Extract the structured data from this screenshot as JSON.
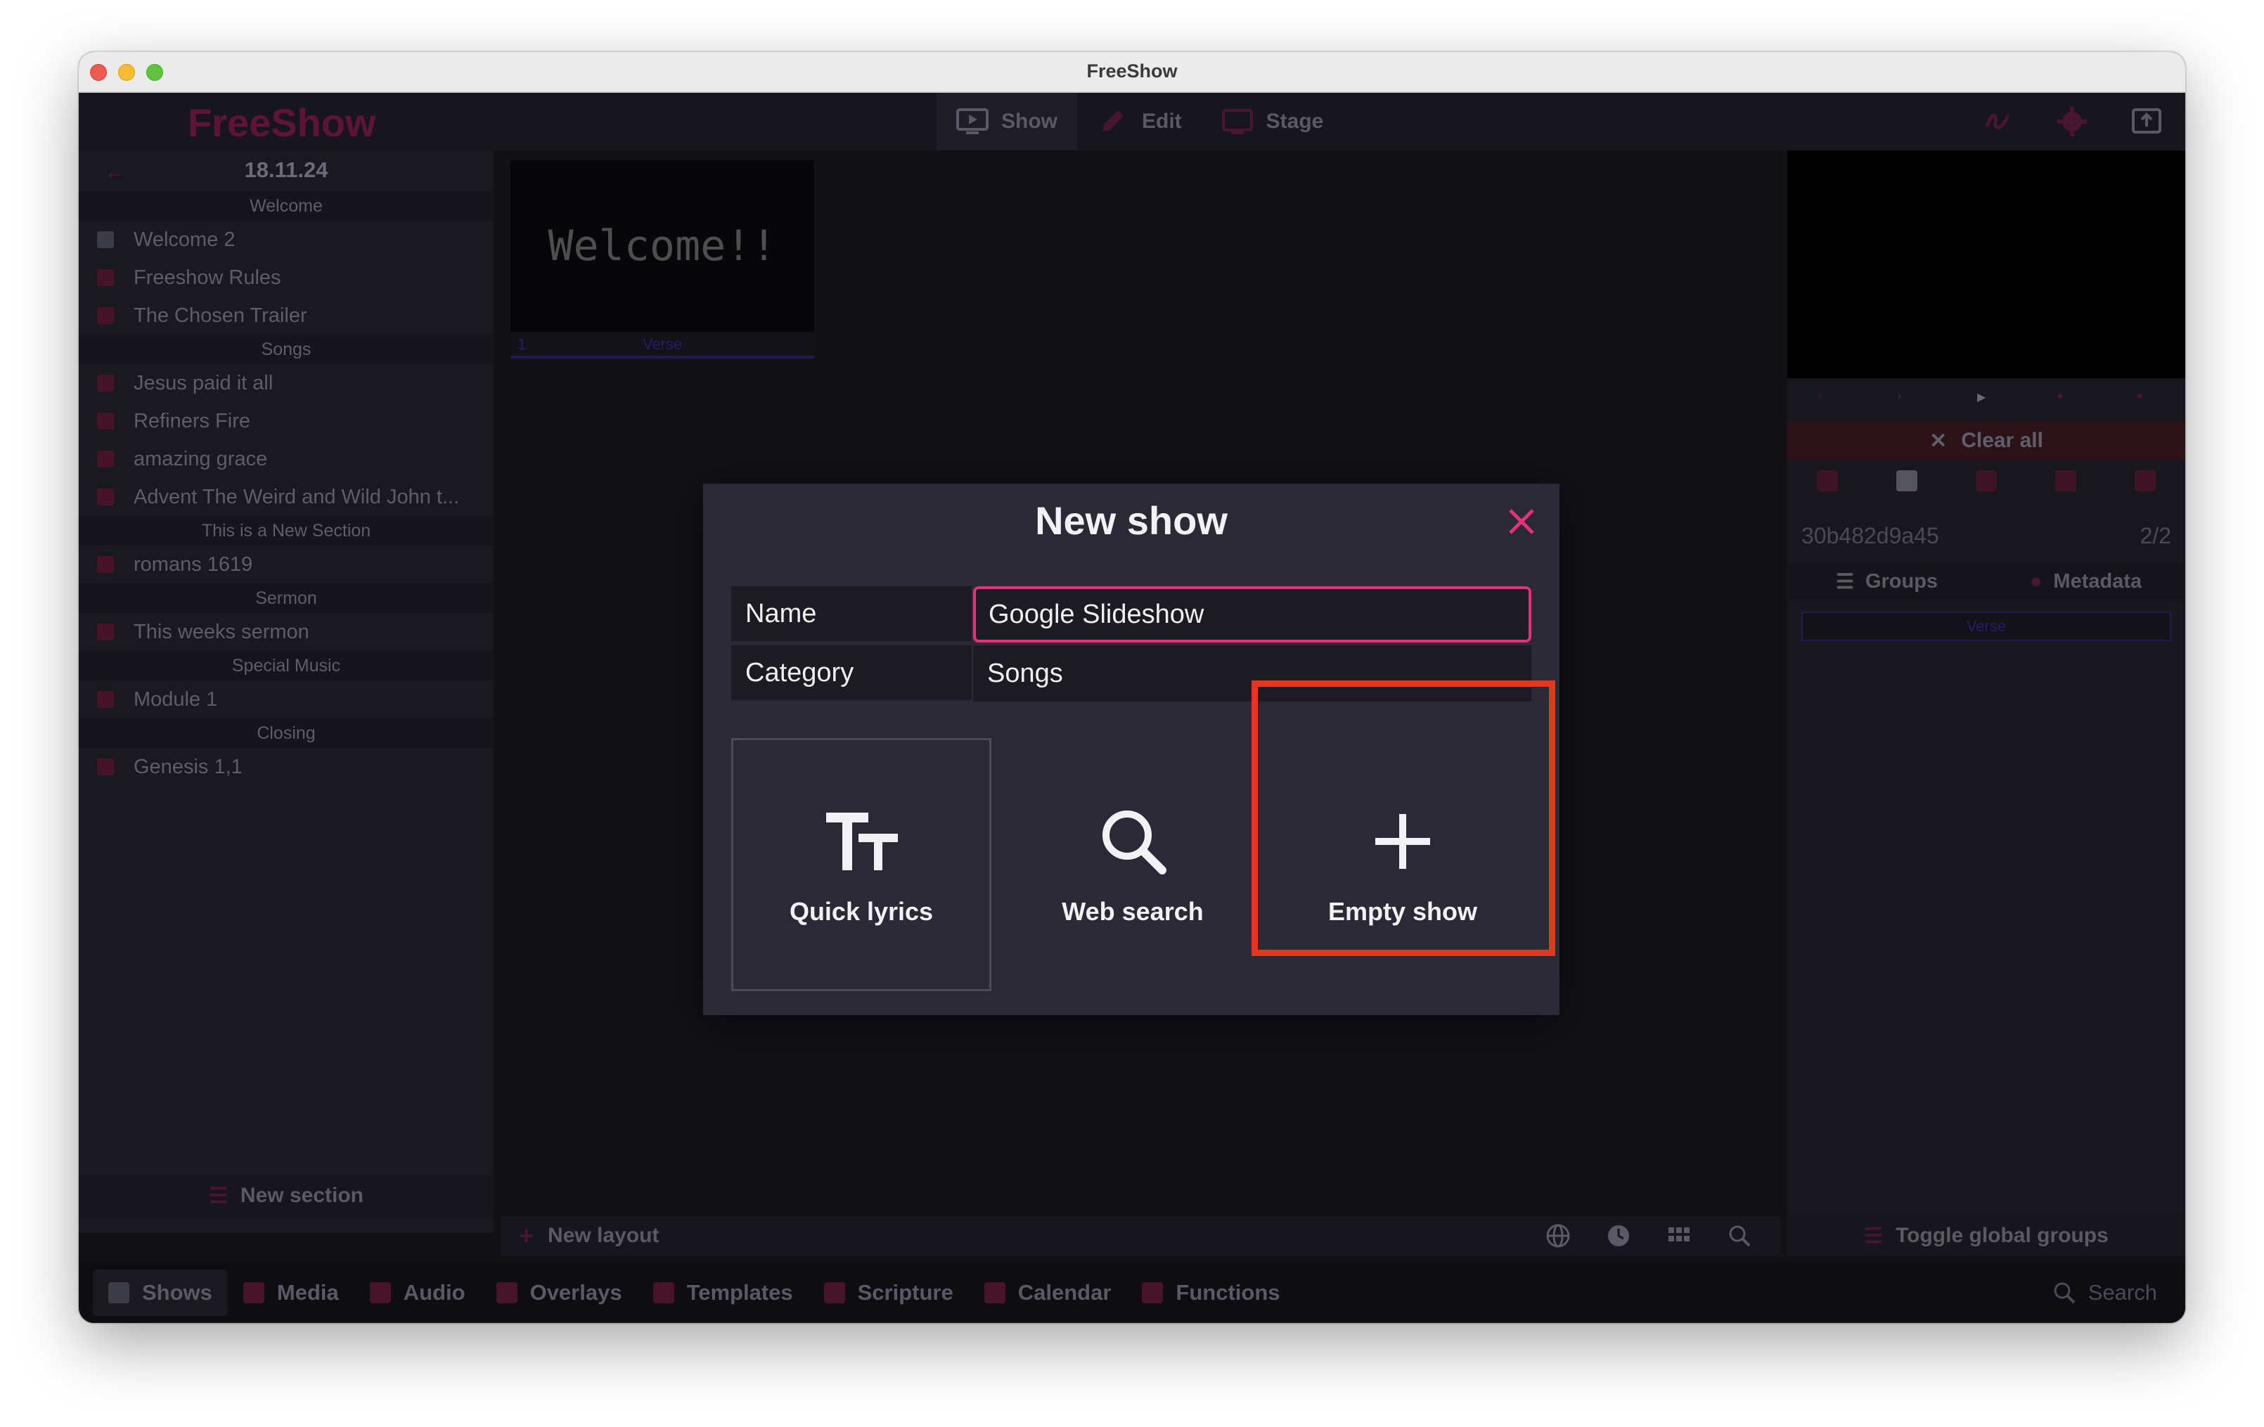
{
  "window": {
    "title": "FreeShow"
  },
  "topbar": {
    "logo": "FreeShow",
    "nav": [
      {
        "label": "Show",
        "icon": "monitor-play-icon"
      },
      {
        "label": "Edit",
        "icon": "pencil-icon"
      },
      {
        "label": "Stage",
        "icon": "cast-icon"
      }
    ],
    "right_icons": [
      "draw-icon",
      "gear-icon",
      "output-icon"
    ]
  },
  "left_panel": {
    "date": "18.11.24",
    "sections": [
      {
        "header": "Welcome",
        "items": [
          {
            "label": "Welcome 2",
            "icon": "document-icon"
          },
          {
            "label": "Freeshow Rules",
            "icon": "presentation-icon"
          },
          {
            "label": "The Chosen Trailer",
            "icon": "presentation-icon"
          }
        ]
      },
      {
        "header": "Songs",
        "items": [
          {
            "label": "Jesus paid it all",
            "icon": "music-icon"
          },
          {
            "label": "Refiners Fire",
            "icon": "music-icon"
          },
          {
            "label": "amazing grace",
            "icon": "music-icon"
          },
          {
            "label": "Advent The Weird and Wild John t...",
            "icon": "document-icon"
          }
        ]
      },
      {
        "header": "This is a New Section",
        "items": [
          {
            "label": "romans 1619",
            "icon": "music-icon"
          }
        ]
      },
      {
        "header": "Sermon",
        "items": [
          {
            "label": "This weeks sermon",
            "icon": "document-icon"
          }
        ]
      },
      {
        "header": "Special Music",
        "items": [
          {
            "label": "Module 1",
            "icon": "video-icon"
          }
        ]
      },
      {
        "header": "Closing",
        "items": [
          {
            "label": "Genesis 1,1",
            "icon": "book-icon"
          }
        ]
      }
    ],
    "footer": "New section"
  },
  "center": {
    "slide_text": "Welcome!!",
    "slide_number": "1",
    "slide_group": "Verse",
    "footer_label": "New layout",
    "footer_icons": [
      "globe-icon",
      "clock-icon",
      "grid-icon",
      "zoom-icon"
    ]
  },
  "right_panel": {
    "clear_all": "Clear all",
    "show_id": "30b482d9a45",
    "count": "2/2",
    "tabs": [
      {
        "label": "Groups",
        "icon": "list-icon"
      },
      {
        "label": "Metadata",
        "icon": "info-icon"
      }
    ],
    "verse": "Verse",
    "footer": "Toggle global groups"
  },
  "bottom_tabs": [
    {
      "label": "Shows",
      "icon": "shows-icon"
    },
    {
      "label": "Media",
      "icon": "media-icon"
    },
    {
      "label": "Audio",
      "icon": "audio-icon"
    },
    {
      "label": "Overlays",
      "icon": "overlays-icon"
    },
    {
      "label": "Templates",
      "icon": "templates-icon"
    },
    {
      "label": "Scripture",
      "icon": "scripture-icon"
    },
    {
      "label": "Calendar",
      "icon": "calendar-icon"
    },
    {
      "label": "Functions",
      "icon": "functions-icon"
    }
  ],
  "search": {
    "label": "Search"
  },
  "modal": {
    "title": "New show",
    "name_label": "Name",
    "name_value": "Google Slideshow",
    "category_label": "Category",
    "category_value": "Songs",
    "options": [
      {
        "label": "Quick lyrics",
        "icon": "text-size-icon"
      },
      {
        "label": "Web search",
        "icon": "search-icon"
      },
      {
        "label": "Empty show",
        "icon": "plus-icon"
      }
    ]
  },
  "colors": {
    "accent": "#e2317a",
    "highlight": "#e0371f",
    "modal_bg": "#2a2935",
    "app_bg": "#121116"
  }
}
